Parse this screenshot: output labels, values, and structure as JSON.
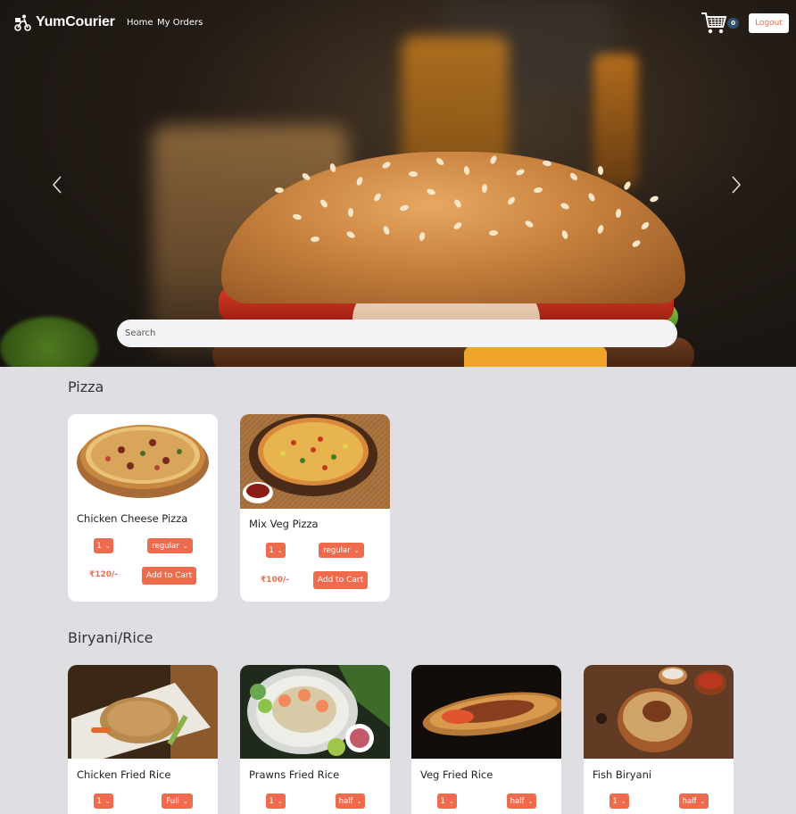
{
  "brand": {
    "name": "YumCourier"
  },
  "nav": {
    "links": [
      "Home",
      "My Orders"
    ],
    "cart_count": "0",
    "logout_label": "Logout"
  },
  "search": {
    "placeholder": "Search"
  },
  "carousel": {
    "prev_icon": "chevron-left-icon",
    "next_icon": "chevron-right-icon"
  },
  "colors": {
    "accent": "#ef6b4e",
    "badge": "#2f4f6e",
    "page_bg": "#dfdee3"
  },
  "categories": [
    {
      "title": "Pizza",
      "items": [
        {
          "name": "Chicken Cheese Pizza",
          "qty": "1",
          "size": "regular",
          "price": "₹120/-",
          "add_label": "Add to Cart"
        },
        {
          "name": "Mix Veg Pizza",
          "qty": "1",
          "size": "regular",
          "price": "₹100/-",
          "add_label": "Add to Cart"
        }
      ]
    },
    {
      "title": "Biryani/Rice",
      "items": [
        {
          "name": "Chicken Fried Rice",
          "qty": "1",
          "size": "Full"
        },
        {
          "name": "Prawns Fried Rice",
          "qty": "1",
          "size": "half"
        },
        {
          "name": "Veg Fried Rice",
          "qty": "1",
          "size": "half"
        },
        {
          "name": "Fish Biryani",
          "qty": "1",
          "size": "half"
        }
      ]
    }
  ]
}
